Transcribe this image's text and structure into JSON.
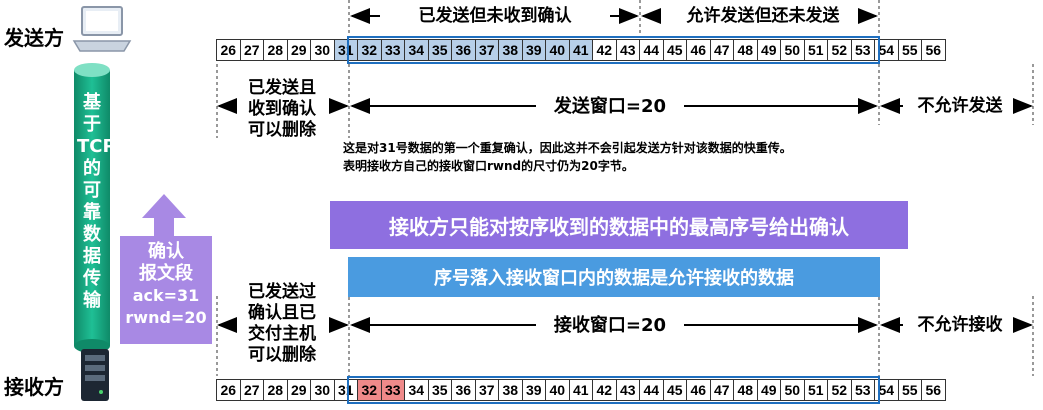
{
  "sender_label": "发送方",
  "receiver_label": "接收方",
  "tcp_channel_label": "基于TCP的可靠数据传输",
  "ack_segment": {
    "title_line1": "确认",
    "title_line2": "报文段",
    "ack": "ack=31",
    "rwnd": "rwnd=20"
  },
  "sender": {
    "top_label_sent_unacked": "已发送但未收到确认",
    "top_label_allowed_unsent": "允许发送但还未发送",
    "acked_label_lines": [
      "已发送且",
      "收到确认",
      "可以删除"
    ],
    "window_label": "发送窗口=20",
    "not_allowed_label": "不允许发送",
    "numbers": [
      "26",
      "27",
      "28",
      "29",
      "30",
      "31",
      "32",
      "33",
      "34",
      "35",
      "36",
      "37",
      "38",
      "39",
      "40",
      "41",
      "42",
      "43",
      "44",
      "45",
      "46",
      "47",
      "48",
      "49",
      "50",
      "51",
      "52",
      "53",
      "54",
      "55",
      "56"
    ],
    "sent_unacked_numbers": [
      "31",
      "32",
      "33",
      "34",
      "35",
      "36",
      "37",
      "38",
      "39",
      "40",
      "41"
    ]
  },
  "notes": [
    "这是对31号数据的第一个重复确认，因此这并不会引起发送方针对该数据的快重传。",
    "表明接收方自己的接收窗口rwnd的尺寸仍为20字节。"
  ],
  "banner_purple": "接收方只能对按序收到的数据中的最高序号给出确认",
  "banner_blue": "序号落入接收窗口内的数据是允许接收的数据",
  "receiver": {
    "acked_label_lines": [
      "已发送过",
      "确认且已",
      "交付主机",
      "可以删除"
    ],
    "window_label": "接收窗口=20",
    "not_allowed_label": "不允许接收",
    "numbers": [
      "26",
      "27",
      "28",
      "29",
      "30",
      "31",
      "32",
      "33",
      "34",
      "35",
      "36",
      "37",
      "38",
      "39",
      "40",
      "41",
      "42",
      "43",
      "44",
      "45",
      "46",
      "47",
      "48",
      "49",
      "50",
      "51",
      "52",
      "53",
      "54",
      "55",
      "56"
    ],
    "received_out_of_order_numbers": [
      "32",
      "33"
    ]
  },
  "colors": {
    "sent_unacked_fill": "#b7cfe8",
    "window_border": "#1f6fbf",
    "out_of_order_fill": "#ef8a8a",
    "tcp_pipe": "#1aa785",
    "purple_banner": "#8e6fe0",
    "blue_banner": "#4a9be0",
    "ack_box": "#a889e4"
  },
  "icons": [
    "laptop-icon",
    "server-icon",
    "up-arrow-icon"
  ]
}
